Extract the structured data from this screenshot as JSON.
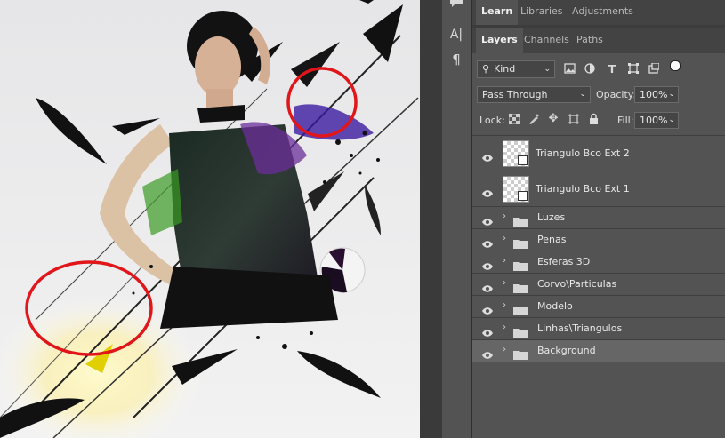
{
  "canvas": {
    "description_icons": [
      "feather-icon",
      "triangle-shape",
      "sphere-shape",
      "annotation-circle"
    ]
  },
  "tools": [
    {
      "icon": "comment-icon"
    },
    {
      "icon": "character-icon",
      "glyph": "A|"
    },
    {
      "icon": "paragraph-icon",
      "glyph": "¶"
    }
  ],
  "top_tabs": [
    {
      "label": "Learn",
      "active": true
    },
    {
      "label": "Libraries",
      "active": false
    },
    {
      "label": "Adjustments",
      "active": false
    }
  ],
  "layer_tabs": [
    {
      "label": "Layers",
      "active": true
    },
    {
      "label": "Channels",
      "active": false
    },
    {
      "label": "Paths",
      "active": false
    }
  ],
  "filter": {
    "value": "Kind"
  },
  "blend": {
    "mode": "Pass Through",
    "opacity_label": "Opacity:",
    "opacity": "100%"
  },
  "lock": {
    "label": "Lock:",
    "fill_label": "Fill:",
    "fill": "100%"
  },
  "layers": [
    {
      "name": "Triangulo Bco Ext 2",
      "type": "smart",
      "selected": false
    },
    {
      "name": "Triangulo Bco Ext 1",
      "type": "smart",
      "selected": false
    },
    {
      "name": "Luzes",
      "type": "group",
      "selected": false
    },
    {
      "name": "Penas",
      "type": "group",
      "selected": false
    },
    {
      "name": "Esferas 3D",
      "type": "group",
      "selected": false
    },
    {
      "name": "Corvo\\Particulas",
      "type": "group",
      "selected": false
    },
    {
      "name": "Modelo",
      "type": "group",
      "selected": false
    },
    {
      "name": "Linhas\\Triangulos",
      "type": "group",
      "selected": false
    },
    {
      "name": "Background",
      "type": "group",
      "selected": true
    }
  ],
  "colors": {
    "panel": "#535353",
    "tab_bar": "#434343",
    "selected_row": "#666666",
    "annotation": "#e0161b"
  }
}
